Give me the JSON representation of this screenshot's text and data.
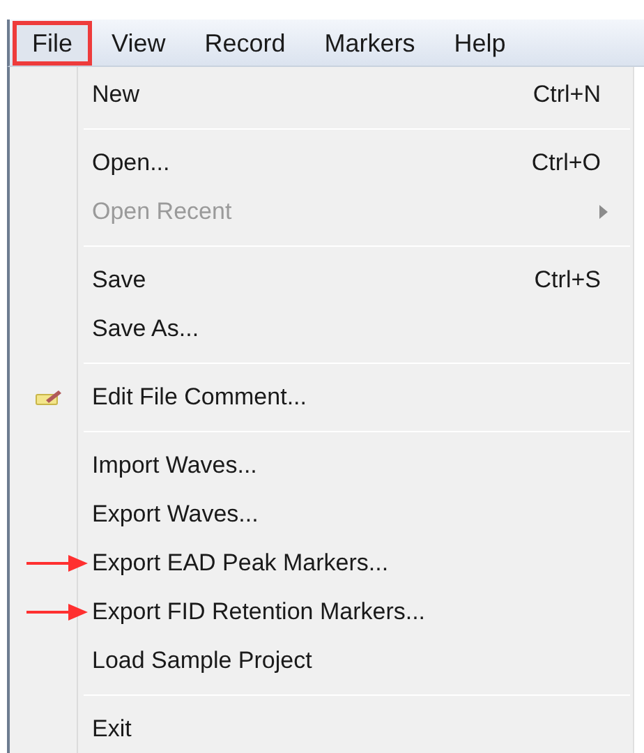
{
  "menubar": [
    {
      "label": "File",
      "selected": true
    },
    {
      "label": "View",
      "selected": false
    },
    {
      "label": "Record",
      "selected": false
    },
    {
      "label": "Markers",
      "selected": false
    },
    {
      "label": "Help",
      "selected": false
    }
  ],
  "menu": [
    {
      "kind": "item",
      "label": "New",
      "shortcut": "Ctrl+N",
      "disabled": false,
      "submenu": false,
      "icon": false,
      "marked": false
    },
    {
      "kind": "separator"
    },
    {
      "kind": "item",
      "label": "Open...",
      "shortcut": "Ctrl+O",
      "disabled": false,
      "submenu": false,
      "icon": false,
      "marked": false
    },
    {
      "kind": "item",
      "label": "Open Recent",
      "disabled": true,
      "submenu": true,
      "icon": false,
      "marked": false
    },
    {
      "kind": "separator"
    },
    {
      "kind": "item",
      "label": "Save",
      "shortcut": "Ctrl+S",
      "disabled": false,
      "submenu": false,
      "icon": false,
      "marked": false
    },
    {
      "kind": "item",
      "label": "Save As...",
      "disabled": false,
      "submenu": false,
      "icon": false,
      "marked": false
    },
    {
      "kind": "separator"
    },
    {
      "kind": "item",
      "label": "Edit File Comment...",
      "disabled": false,
      "submenu": false,
      "icon": true,
      "marked": false
    },
    {
      "kind": "separator"
    },
    {
      "kind": "item",
      "label": "Import Waves...",
      "disabled": false,
      "submenu": false,
      "icon": false,
      "marked": false
    },
    {
      "kind": "item",
      "label": "Export Waves...",
      "disabled": false,
      "submenu": false,
      "icon": false,
      "marked": false
    },
    {
      "kind": "item",
      "label": "Export EAD Peak Markers...",
      "disabled": false,
      "submenu": false,
      "icon": false,
      "marked": true
    },
    {
      "kind": "item",
      "label": "Export FID Retention Markers...",
      "disabled": false,
      "submenu": false,
      "icon": false,
      "marked": true
    },
    {
      "kind": "item",
      "label": "Load Sample Project",
      "disabled": false,
      "submenu": false,
      "icon": false,
      "marked": false
    },
    {
      "kind": "separator"
    },
    {
      "kind": "item",
      "label": "Exit",
      "disabled": false,
      "submenu": false,
      "icon": false,
      "marked": false
    }
  ]
}
